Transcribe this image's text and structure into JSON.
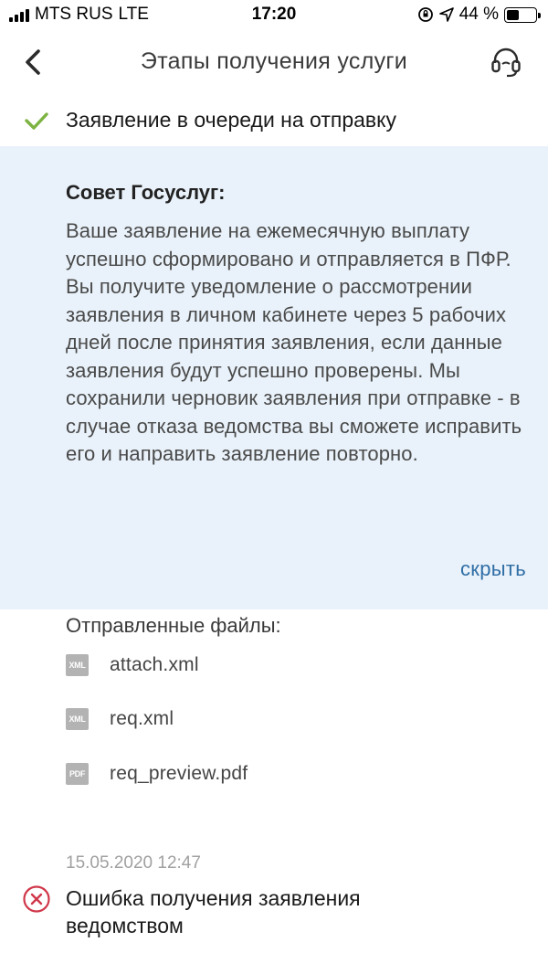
{
  "status_bar": {
    "carrier": "MTS RUS",
    "network": "LTE",
    "time": "17:20",
    "battery": "44 %",
    "battery_level": 0.44
  },
  "nav": {
    "title": "Этапы получения услуги",
    "back_icon": "chevron-left-icon",
    "support_icon": "headset-icon"
  },
  "step_done": {
    "title": "Заявление в очереди на отправку",
    "icon": "check-icon",
    "icon_color": "#7cb342"
  },
  "tip": {
    "title": "Совет Госуслуг:",
    "text": "Ваше заявление на ежемесячную выплату успешно сформировано и отправляется в ПФР. Вы получите уведомление о рассмотрении заявления в личном кабинете через 5 рабочих дней после принятия заявления, если данные заявления будут успешно проверены. Мы сохранили черновик заявления при отправке - в случае отказа ведомства вы сможете исправить его и направить заявление повторно.",
    "hide_label": "скрыть",
    "background": "#e9f2fa",
    "link_color": "#2f6ea5"
  },
  "files": {
    "title": "Отправленные файлы:",
    "items": [
      {
        "type": "XML",
        "name": "attach.xml"
      },
      {
        "type": "XML",
        "name": "req.xml"
      },
      {
        "type": "PDF",
        "name": "req_preview.pdf"
      }
    ]
  },
  "error_step": {
    "date": "15.05.2020 12:47",
    "title": "Ошибка получения заявления ведомством",
    "icon": "error-circle-icon",
    "icon_color": "#d0374a"
  }
}
